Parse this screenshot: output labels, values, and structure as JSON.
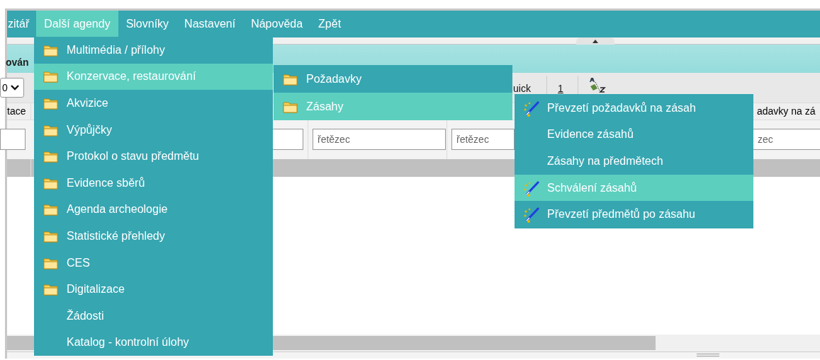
{
  "menubar": {
    "items": [
      {
        "label": "zitář",
        "selected": false
      },
      {
        "label": "Další agendy",
        "selected": true
      },
      {
        "label": "Slovníky",
        "selected": false
      },
      {
        "label": "Nastavení",
        "selected": false
      },
      {
        "label": "Nápověda",
        "selected": false
      },
      {
        "label": "Zpět",
        "selected": false
      }
    ]
  },
  "dropdown": {
    "items": [
      {
        "label": "Multimédia / přílohy",
        "kind": "folder",
        "selected": false
      },
      {
        "label": "Konzervace, restaurování",
        "kind": "folder",
        "selected": true
      },
      {
        "label": "Akvizice",
        "kind": "folder",
        "selected": false
      },
      {
        "label": "Výpůjčky",
        "kind": "folder",
        "selected": false
      },
      {
        "label": "Protokol o stavu předmětu",
        "kind": "folder",
        "selected": false
      },
      {
        "label": "Evidence sběrů",
        "kind": "folder",
        "selected": false
      },
      {
        "label": "Agenda archeologie",
        "kind": "folder",
        "selected": false
      },
      {
        "label": "Statistické přehledy",
        "kind": "folder",
        "selected": false
      },
      {
        "label": "CES",
        "kind": "folder",
        "selected": false
      },
      {
        "label": "Digitalizace",
        "kind": "folder",
        "selected": false
      },
      {
        "label": "Žádosti",
        "kind": "plain",
        "selected": false
      },
      {
        "label": "Katalog - kontrolní úlohy",
        "kind": "plain",
        "selected": false
      }
    ]
  },
  "submenu": {
    "items": [
      {
        "label": "Požadavky",
        "kind": "folder",
        "selected": false
      },
      {
        "label": "Zásahy",
        "kind": "folder",
        "selected": true
      }
    ]
  },
  "submenu_2": {
    "items": [
      {
        "label": "Převzetí požadavků na zásah",
        "kind": "wand",
        "selected": false
      },
      {
        "label": "Evidence zásahů",
        "kind": "plain",
        "selected": false
      },
      {
        "label": "Zásahy na předmětech",
        "kind": "plain",
        "selected": false
      },
      {
        "label": "Schválení zásahů",
        "kind": "wand",
        "selected": true
      },
      {
        "label": "Převzetí předmětů po zásahu",
        "kind": "wand",
        "selected": false
      }
    ]
  },
  "page": {
    "title": "ován",
    "select_value": "0",
    "toolbar": [
      "uick",
      "1"
    ],
    "columns": [
      "tace",
      "adavky na zá"
    ],
    "filters": [
      {
        "placeholder": "řetězec"
      },
      {
        "placeholder": "řetězec"
      },
      {
        "placeholder": "zec"
      }
    ]
  }
}
